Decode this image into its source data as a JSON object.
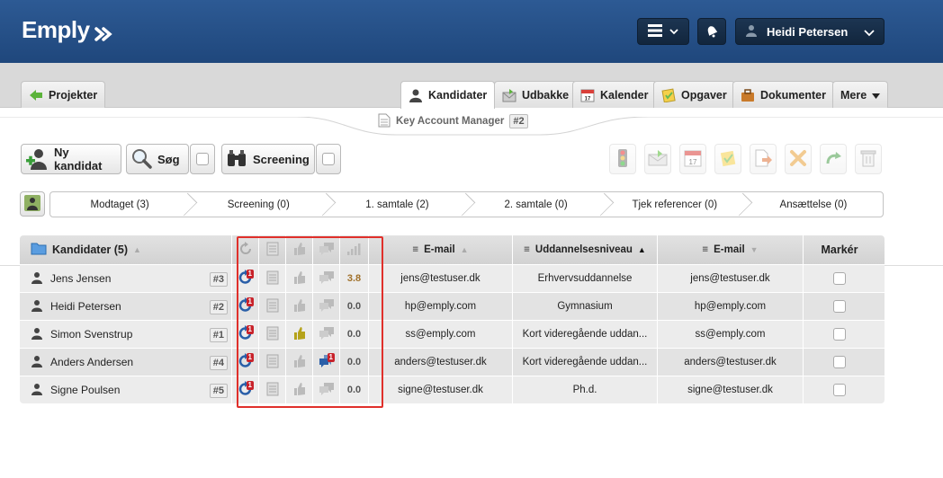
{
  "header": {
    "logo": "Emply",
    "user_name": "Heidi Petersen"
  },
  "tabs": {
    "projects": "Projekter",
    "candidates": "Kandidater",
    "outbox": "Udbakke",
    "calendar": "Kalender",
    "tasks": "Opgaver",
    "documents": "Dokumenter",
    "more": "Mere"
  },
  "subtitle": {
    "title": "Key Account Manager",
    "number": "#2"
  },
  "toolbar": {
    "new_candidate": "Ny kandidat",
    "search": "Søg",
    "screening": "Screening"
  },
  "pipeline": [
    "Modtaget (3)",
    "Screening (0)",
    "1. samtale (2)",
    "2. samtale (0)",
    "Tjek referencer (0)",
    "Ansættelse (0)"
  ],
  "table": {
    "headers": {
      "candidates": "Kandidater (5)",
      "email": "E-mail",
      "education": "Uddannelsesniveau",
      "email2": "E-mail",
      "mark": "Markér"
    },
    "rows": [
      {
        "name": "Jens Jensen",
        "num": "#3",
        "badge": "1",
        "score": "3.8",
        "email": "jens@testuser.dk",
        "edu": "Erhvervsuddannelse",
        "email2": "jens@testuser.dk",
        "thumb": "grey",
        "comment": "grey"
      },
      {
        "name": "Heidi Petersen",
        "num": "#2",
        "badge": "1",
        "score": "0.0",
        "email": "hp@emply.com",
        "edu": "Gymnasium",
        "email2": "hp@emply.com",
        "thumb": "grey",
        "comment": "grey"
      },
      {
        "name": "Simon Svenstrup",
        "num": "#1",
        "badge": "1",
        "score": "0.0",
        "email": "ss@emply.com",
        "edu": "Kort videregående uddan...",
        "email2": "ss@emply.com",
        "thumb": "yellow",
        "comment": "grey"
      },
      {
        "name": "Anders Andersen",
        "num": "#4",
        "badge": "1",
        "score": "0.0",
        "email": "anders@testuser.dk",
        "edu": "Kort videregående uddan...",
        "email2": "anders@testuser.dk",
        "thumb": "grey",
        "comment": "blue",
        "comment_badge": "1"
      },
      {
        "name": "Signe Poulsen",
        "num": "#5",
        "badge": "1",
        "score": "0.0",
        "email": "signe@testuser.dk",
        "edu": "Ph.d.",
        "email2": "signe@testuser.dk",
        "thumb": "grey",
        "comment": "grey"
      }
    ]
  },
  "colors": {
    "header_bg": "#1f477c",
    "highlight_border": "#e0302b",
    "badge_red": "#c8222a"
  }
}
